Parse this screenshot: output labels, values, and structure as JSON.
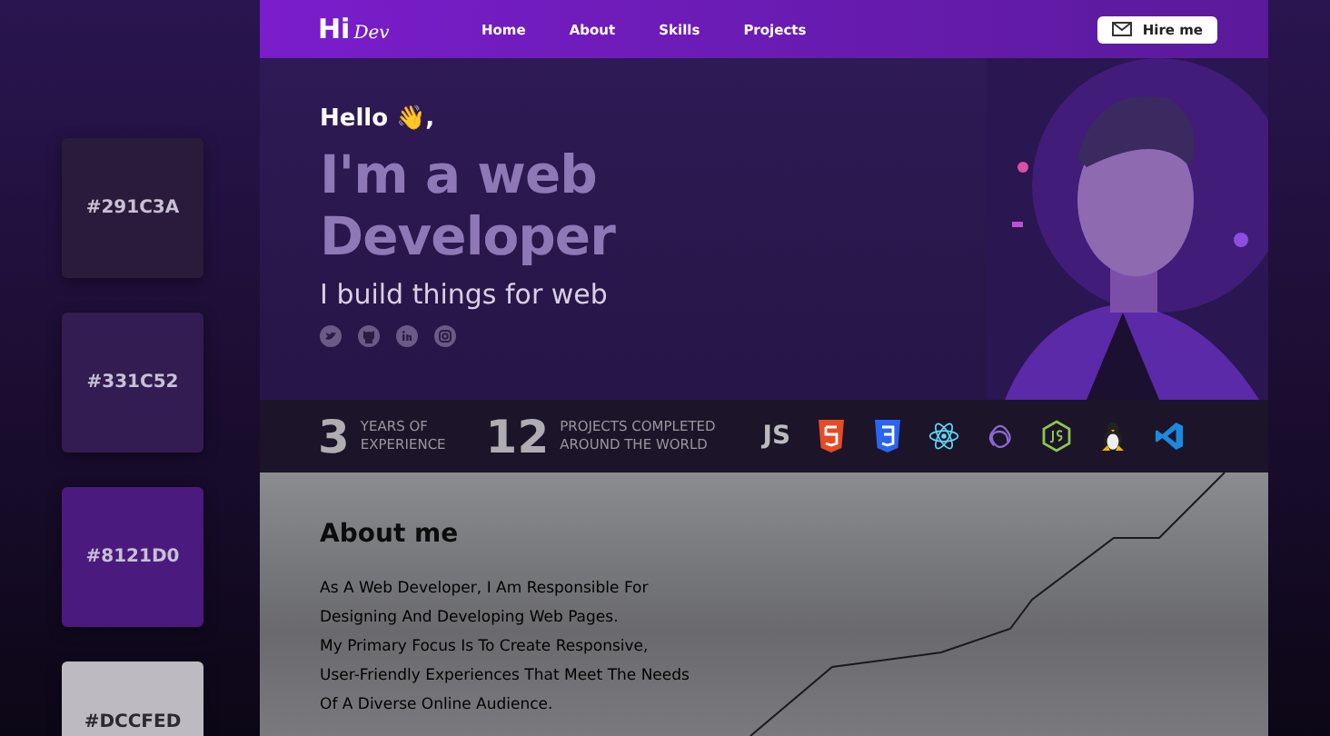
{
  "swatches": [
    {
      "label": "#291C3A",
      "color": "#291c3a"
    },
    {
      "label": "#331C52",
      "color": "#331c52"
    },
    {
      "label": "#8121D0",
      "color": "#4a1a7e"
    },
    {
      "label": "#DCCFED",
      "color": "#bdbac2"
    }
  ],
  "nav": {
    "logo_mark": "Hi",
    "logo_text": "Dev",
    "links": [
      "Home",
      "About",
      "Skills",
      "Projects"
    ],
    "button": "Hire me"
  },
  "hero": {
    "greeting": "Hello 👋,",
    "title": [
      "I'm a web",
      "Developer"
    ],
    "subtitle": "I build things for web"
  },
  "stats": [
    {
      "number": "3",
      "label": [
        "YEARS OF",
        "EXPERIENCE"
      ]
    },
    {
      "number": "12",
      "label": [
        "PROJECTS COMPLETED",
        "AROUND THE WORLD"
      ]
    }
  ],
  "tech": [
    {
      "kind": "js",
      "text": "JS"
    },
    {
      "kind": "html"
    },
    {
      "kind": "css"
    },
    {
      "kind": "react"
    },
    {
      "kind": "redux"
    },
    {
      "kind": "node"
    },
    {
      "kind": "linux"
    },
    {
      "kind": "vscode"
    }
  ],
  "about": {
    "heading": "About me",
    "lines": [
      "As A Web Developer, I Am Responsible For",
      "Designing And Developing Web Pages.",
      "My Primary Focus Is To Create Responsive,",
      "User-Friendly Experiences That Meet The Needs",
      "Of A Diverse Online Audience."
    ]
  }
}
